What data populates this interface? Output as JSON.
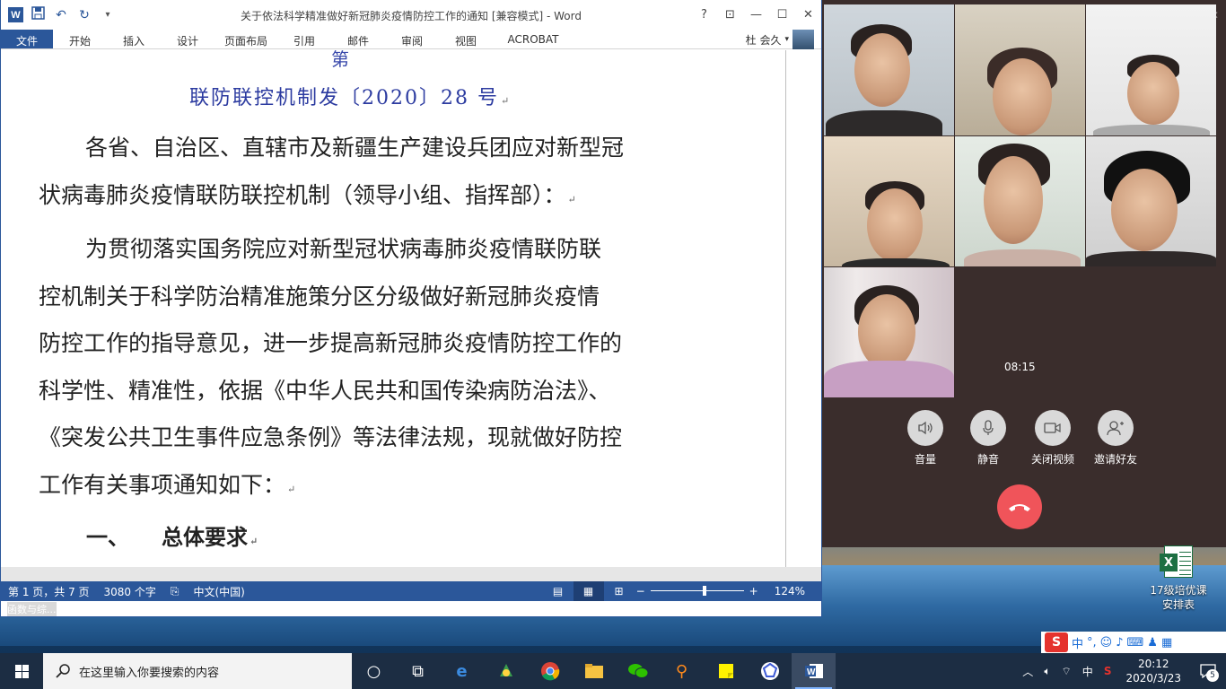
{
  "word": {
    "title": "关于依法科学精准做好新冠肺炎疫情防控工作的通知 [兼容模式] - Word",
    "qat": {
      "logo": "W",
      "save_icon": "save-icon",
      "undo_icon": "undo-icon",
      "redo_icon": "redo-icon",
      "customize_icon": "customize-icon"
    },
    "window_controls": {
      "help": "?",
      "ribbon_display": "⊡",
      "minimize": "—",
      "maximize": "☐",
      "close": "✕"
    },
    "tabs": [
      "文件",
      "开始",
      "插入",
      "设计",
      "页面布局",
      "引用",
      "邮件",
      "审阅",
      "视图",
      "ACROBAT"
    ],
    "user": "杜 会久",
    "document": {
      "cut_top_glyph": "第",
      "doc_number": "联防联控机制发〔2020〕28 号",
      "para1_lines": [
        "各省、自治区、直辖市及新疆生产建设兵团应对新型冠",
        "状病毒肺炎疫情联防联控机制（领导小组、指挥部）："
      ],
      "para2_lines": [
        "为贯彻落实国务院应对新型冠状病毒肺炎疫情联防联",
        "控机制关于科学防治精准施策分区分级做好新冠肺炎疫情",
        "防控工作的指导意见，进一步提高新冠肺炎疫情防控工作的",
        "科学性、精准性，依据《中华人民共和国传染病防治法》、",
        "《突发公共卫生事件应急条例》等法律法规，现就做好防控",
        "工作有关事项通知如下："
      ],
      "heading_number": "一、",
      "heading_text": "总体要求",
      "para_mark": "↵"
    },
    "status": {
      "page": "第 1 页，共 7 页",
      "words": "3080 个字",
      "language": "中文(中国)",
      "zoom_minus": "−",
      "zoom_plus": "+",
      "zoom": "124%"
    },
    "hint": "函数与综..."
  },
  "call": {
    "timer": "08:15",
    "controls": [
      {
        "label": "音量",
        "icon": "speaker-icon"
      },
      {
        "label": "静音",
        "icon": "microphone-icon"
      },
      {
        "label": "关闭视频",
        "icon": "camera-icon"
      },
      {
        "label": "邀请好友",
        "icon": "add-friend-icon"
      }
    ],
    "hangup_icon": "hangup-icon"
  },
  "desktop": {
    "file_icon_label_lines": [
      "17级培优课",
      "安排表"
    ]
  },
  "ime": {
    "logo": "S",
    "mode": "中",
    "punct": "°,"
  },
  "taskbar": {
    "search_placeholder": "在这里输入你要搜索的内容",
    "tray": {
      "ime": "中",
      "time": "20:12",
      "date": "2020/3/23",
      "notifications": "5"
    }
  }
}
